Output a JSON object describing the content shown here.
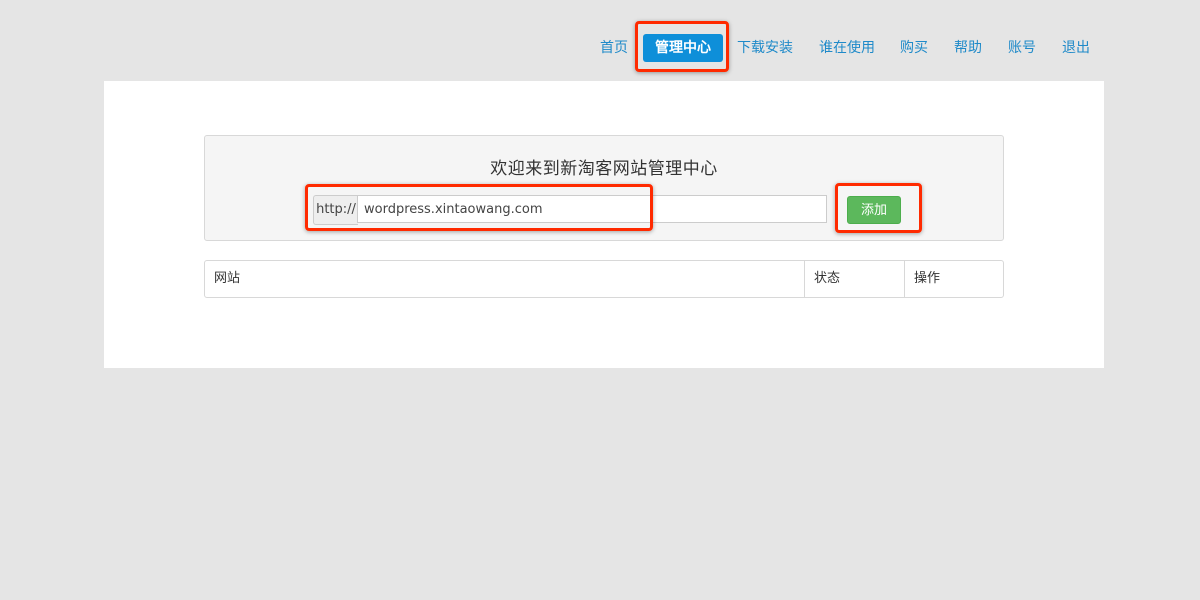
{
  "nav": {
    "items": [
      {
        "label": "首页"
      },
      {
        "label": "管理中心",
        "active": true
      },
      {
        "label": "下载安装"
      },
      {
        "label": "谁在使用"
      },
      {
        "label": "购买"
      },
      {
        "label": "帮助"
      },
      {
        "label": "账号"
      },
      {
        "label": "退出"
      }
    ]
  },
  "main": {
    "welcome_title": "欢迎来到新淘客网站管理中心",
    "url_prefix": "http://",
    "url_value": "wordpress.xintaowang.com",
    "add_button_label": "添加",
    "table": {
      "headers": [
        "网站",
        "状态",
        "操作"
      ]
    }
  },
  "colors": {
    "background": "#e5e5e5",
    "link": "#1f8ac9",
    "nav_active": "#0e8fd9",
    "add_button": "#5cb85c",
    "highlight": "#ff2a00"
  }
}
